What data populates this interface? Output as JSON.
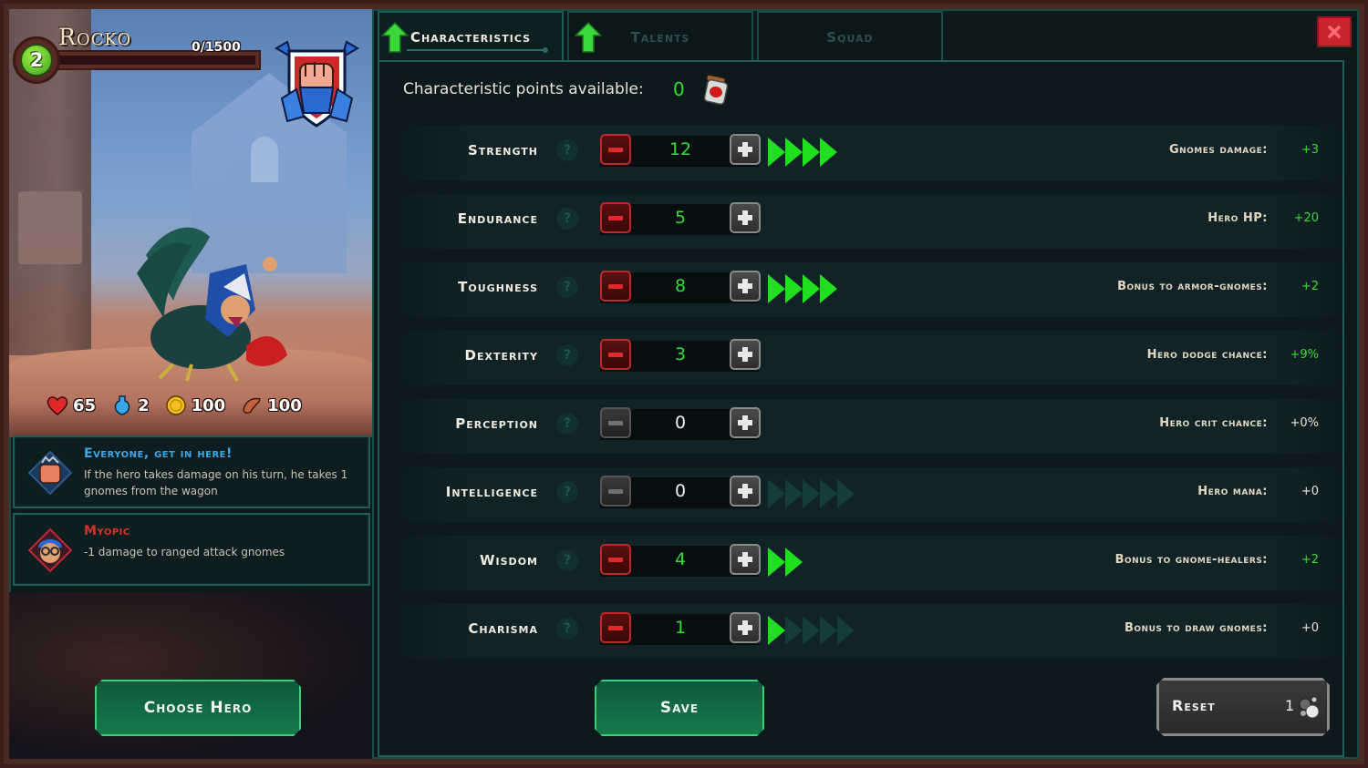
{
  "hero": {
    "name": "Rocko",
    "level": "2",
    "xp_text": "0/1500",
    "xp_fraction": 0.0,
    "resources": [
      {
        "icon": "heart-icon",
        "value": "65"
      },
      {
        "icon": "mana-potion-icon",
        "value": "2"
      },
      {
        "icon": "gold-coin-icon",
        "value": "100"
      },
      {
        "icon": "sausage-icon",
        "value": "100"
      }
    ],
    "traits": [
      {
        "icon": "fist-gauntlet-icon",
        "title": "Everyone, get in here!",
        "title_color": "#3aa8e8",
        "description": "If the hero takes damage on his turn, he takes 1 gnomes from the wagon"
      },
      {
        "icon": "myopic-gnome-icon",
        "title": "Myopic",
        "title_color": "#d8342c",
        "description": "-1 damage to ranged attack gnomes"
      }
    ],
    "choose_hero_label": "Choose Hero"
  },
  "tabs": [
    {
      "label": "Characteristics",
      "active": true,
      "has_upgrade": true
    },
    {
      "label": "Talents",
      "active": false,
      "has_upgrade": true
    },
    {
      "label": "Squad",
      "active": false,
      "has_upgrade": false
    }
  ],
  "points": {
    "label": "Characteristic points available:",
    "value": "0"
  },
  "stats": [
    {
      "name": "Strength",
      "value": "12",
      "minus_enabled": true,
      "arrows_on": 4,
      "arrows_total": 4,
      "bonus_label": "Gnomes damage:",
      "bonus_value": "+3",
      "bonus_positive": true
    },
    {
      "name": "Endurance",
      "value": "5",
      "minus_enabled": true,
      "arrows_on": 0,
      "arrows_total": 0,
      "bonus_label": "Hero HP:",
      "bonus_value": "+20",
      "bonus_positive": true
    },
    {
      "name": "Toughness",
      "value": "8",
      "minus_enabled": true,
      "arrows_on": 4,
      "arrows_total": 4,
      "bonus_label": "Bonus to armor-gnomes:",
      "bonus_value": "+2",
      "bonus_positive": true
    },
    {
      "name": "Dexterity",
      "value": "3",
      "minus_enabled": true,
      "arrows_on": 0,
      "arrows_total": 0,
      "bonus_label": "Hero dodge chance:",
      "bonus_value": "+9%",
      "bonus_positive": true
    },
    {
      "name": "Perception",
      "value": "0",
      "minus_enabled": false,
      "arrows_on": 0,
      "arrows_total": 0,
      "bonus_label": "Hero crit chance:",
      "bonus_value": "+0%",
      "bonus_positive": false
    },
    {
      "name": "Intelligence",
      "value": "0",
      "minus_enabled": false,
      "arrows_on": 0,
      "arrows_total": 5,
      "bonus_label": "Hero mana:",
      "bonus_value": "+0",
      "bonus_positive": false
    },
    {
      "name": "Wisdom",
      "value": "4",
      "minus_enabled": true,
      "arrows_on": 2,
      "arrows_total": 2,
      "bonus_label": "Bonus to gnome-healers:",
      "bonus_value": "+2",
      "bonus_positive": true
    },
    {
      "name": "Charisma",
      "value": "1",
      "minus_enabled": true,
      "arrows_on": 1,
      "arrows_total": 5,
      "bonus_label": "Bonus to draw gnomes:",
      "bonus_value": "+0",
      "bonus_positive": false
    }
  ],
  "help_glyph": "?",
  "buttons": {
    "save": "Save",
    "reset": "Reset",
    "reset_count": "1"
  }
}
